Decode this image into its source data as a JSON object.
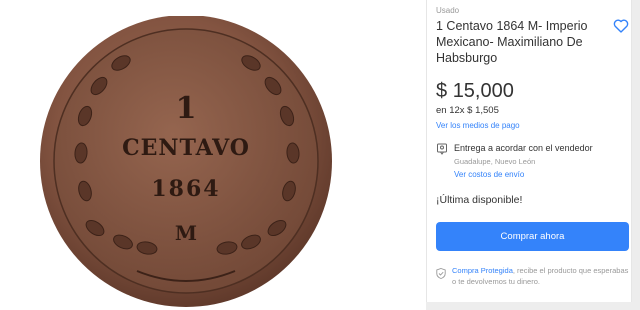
{
  "listing": {
    "condition": "Usado",
    "title": "1 Centavo 1864 M- Imperio Mexicano- Maximiliano De Habsburgo",
    "currency": "$",
    "price": "15,000",
    "installments": "en 12x $ 1,505",
    "payment_link": "Ver los medios de pago"
  },
  "shipping": {
    "title": "Entrega a acordar con el vendedor",
    "location": "Guadalupe, Nuevo León",
    "cost_link": "Ver costos de envío"
  },
  "availability": "¡Última disponible!",
  "buy_button": "Comprar ahora",
  "protection": {
    "link": "Compra Protegida",
    "text": ", recibe el producto que esperabas o te devolvemos tu dinero."
  },
  "coin": {
    "line1": "1",
    "line2": "CENTAVO",
    "line3": "1864",
    "mint": "M"
  },
  "icons": {
    "favorite": "heart-icon",
    "shipping": "map-pin-icon",
    "protection": "shield-check-icon"
  },
  "colors": {
    "accent": "#3483fa",
    "coin_copper": "#8a5a45",
    "muted_text": "#999999"
  }
}
